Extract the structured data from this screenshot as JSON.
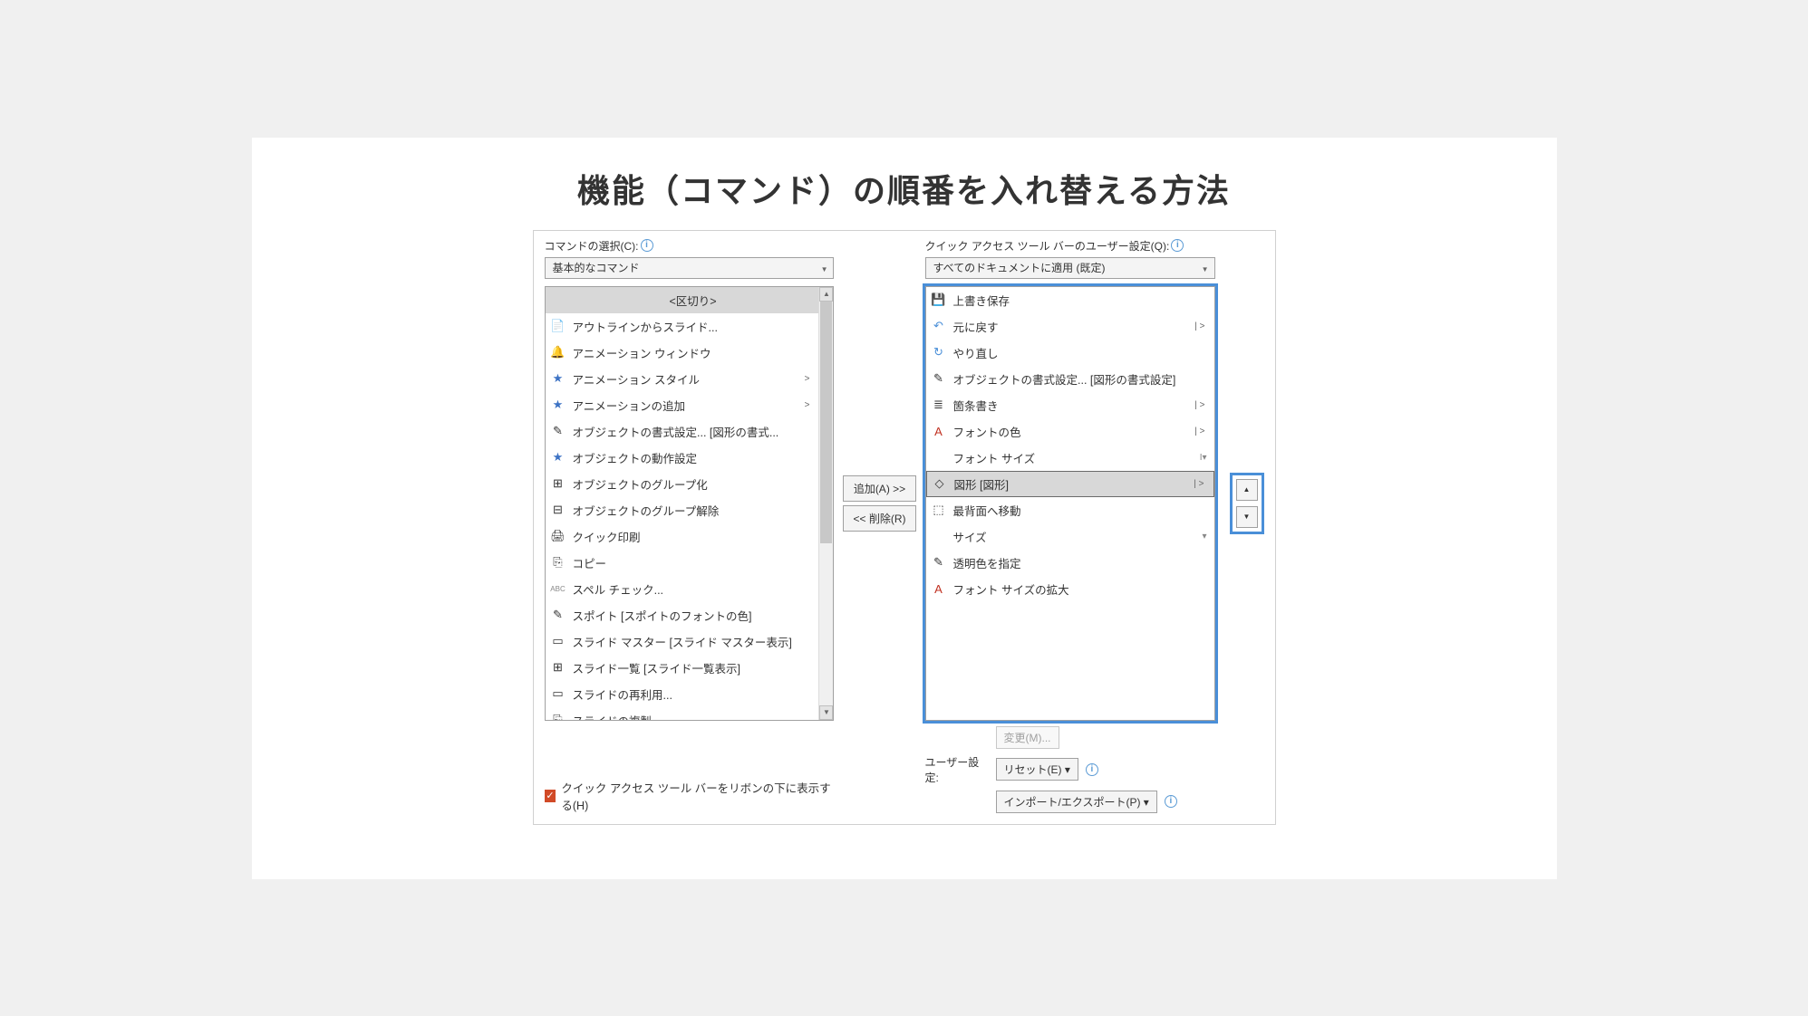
{
  "heading": "機能（コマンド）の順番を入れ替える方法",
  "left_label": "コマンドの選択(C):",
  "left_select": "基本的なコマンド",
  "right_label": "クイック アクセス ツール バーのユーザー設定(Q):",
  "right_select": "すべてのドキュメントに適用 (既定)",
  "left_items": [
    {
      "label": "<区切り>",
      "icon": ""
    },
    {
      "label": "アウトラインからスライド...",
      "icon": "📄"
    },
    {
      "label": "アニメーション ウィンドウ",
      "icon": "🔔"
    },
    {
      "label": "アニメーション スタイル",
      "icon": "★",
      "chev": true
    },
    {
      "label": "アニメーションの追加",
      "icon": "★",
      "chev": true
    },
    {
      "label": "オブジェクトの書式設定... [図形の書式...",
      "icon": "✎"
    },
    {
      "label": "オブジェクトの動作設定",
      "icon": "★"
    },
    {
      "label": "オブジェクトのグループ化",
      "icon": "⊞"
    },
    {
      "label": "オブジェクトのグループ解除",
      "icon": "⊟"
    },
    {
      "label": "クイック印刷",
      "icon": "🖨"
    },
    {
      "label": "コピー",
      "icon": "⎘"
    },
    {
      "label": "スペル チェック...",
      "icon": "ABC"
    },
    {
      "label": "スポイト [スポイトのフォントの色]",
      "icon": "✎"
    },
    {
      "label": "スライド マスター [スライド マスター表示]",
      "icon": "▭"
    },
    {
      "label": "スライド一覧 [スライド一覧表示]",
      "icon": "⊞"
    },
    {
      "label": "スライドの再利用...",
      "icon": "▭"
    },
    {
      "label": "スライドの複製",
      "icon": "⎘"
    }
  ],
  "right_items": [
    {
      "label": "上書き保存",
      "icon": "💾"
    },
    {
      "label": "元に戻す",
      "icon": "↶",
      "chev": true
    },
    {
      "label": "やり直し",
      "icon": "↻"
    },
    {
      "label": "オブジェクトの書式設定... [図形の書式設定]",
      "icon": "✎"
    },
    {
      "label": "箇条書き",
      "icon": "≣",
      "chev": true
    },
    {
      "label": "フォントの色",
      "icon": "A",
      "chev": true
    },
    {
      "label": "フォント サイズ",
      "icon": "",
      "badge": "I▾"
    },
    {
      "label": "図形 [図形]",
      "icon": "◇",
      "selected": true,
      "chev": true
    },
    {
      "label": "最背面へ移動",
      "icon": "⬚"
    },
    {
      "label": "サイズ",
      "icon": "",
      "badge": "▾"
    },
    {
      "label": "透明色を指定",
      "icon": "✎"
    },
    {
      "label": "フォント サイズの拡大",
      "icon": "A"
    }
  ],
  "btn_add": "追加(A) >>",
  "btn_remove": "<< 削除(R)",
  "btn_modify": "変更(M)...",
  "custom_label": "ユーザー設定:",
  "btn_reset": "リセット(E) ▾",
  "btn_import": "インポート/エクスポート(P) ▾",
  "check_label": "クイック アクセス ツール バーをリボンの下に表示する(H)"
}
